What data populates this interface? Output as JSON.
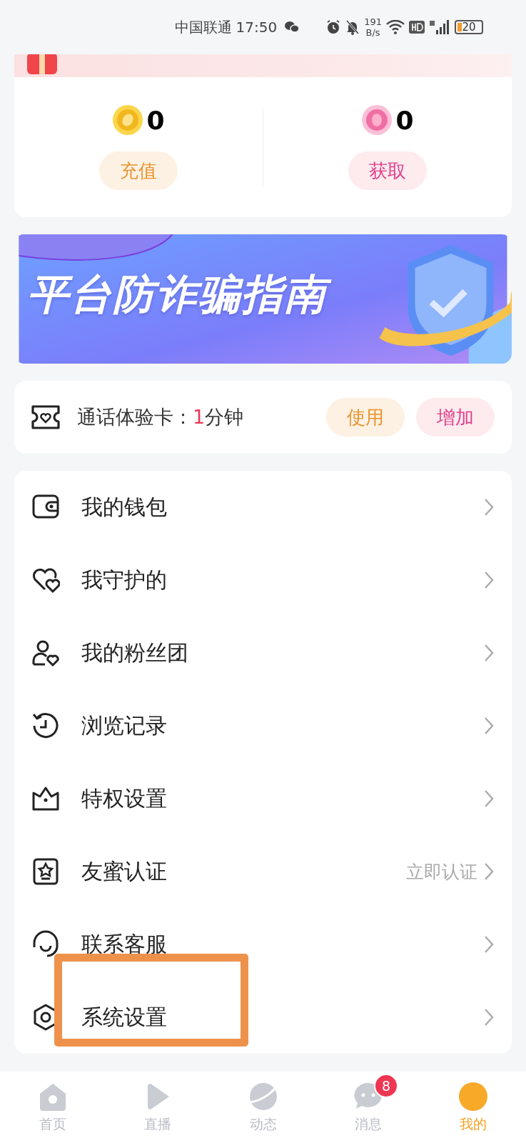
{
  "status_bar": {
    "carrier": "中国联通",
    "time": "17:50",
    "net_speed": "191",
    "net_unit": "B/s",
    "battery": "20"
  },
  "wallet": [
    {
      "kind": "coin",
      "amount": "0",
      "button": "充值"
    },
    {
      "kind": "gem",
      "amount": "0",
      "button": "获取"
    }
  ],
  "banner": {
    "title": "平台防诈骗指南"
  },
  "call_card": {
    "label": "通话体验卡：",
    "minutes": "1",
    "unit": "分钟",
    "buttons": [
      {
        "kind": "use",
        "label": "使用"
      },
      {
        "kind": "add",
        "label": "增加"
      }
    ]
  },
  "menu": [
    {
      "kind": "wallet",
      "label": "我的钱包",
      "highlighted": false
    },
    {
      "kind": "hearts",
      "label": "我守护的",
      "highlighted": false
    },
    {
      "kind": "fan",
      "label": "我的粉丝团",
      "highlighted": false
    },
    {
      "kind": "history",
      "label": "浏览记录",
      "highlighted": false
    },
    {
      "kind": "crown",
      "label": "特权设置",
      "highlighted": false
    },
    {
      "kind": "star",
      "label": "友蜜认证",
      "hint": "立即认证",
      "highlighted": false
    },
    {
      "kind": "headset",
      "label": "联系客服",
      "highlighted": false
    },
    {
      "kind": "gear",
      "label": "系统设置",
      "highlighted": true
    }
  ],
  "tabs": [
    {
      "kind": "home",
      "label": "首页",
      "selected": false
    },
    {
      "kind": "play",
      "label": "直播",
      "selected": false
    },
    {
      "kind": "planet",
      "label": "动态",
      "selected": false
    },
    {
      "kind": "chat",
      "label": "消息",
      "selected": false,
      "badge": "8"
    },
    {
      "kind": "face",
      "label": "我的",
      "selected": true
    }
  ]
}
